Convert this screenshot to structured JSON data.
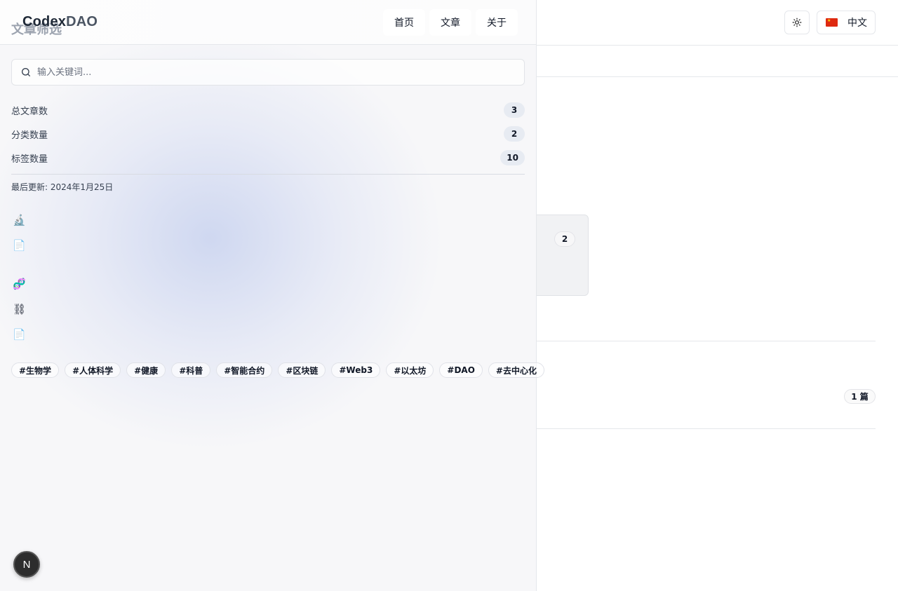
{
  "header": {
    "brand_part1": "Codex",
    "brand_part2": "DAO",
    "nav": [
      "首页",
      "文章",
      "关于"
    ],
    "language": "中文"
  },
  "panel": {
    "title": "文章筛选",
    "search_placeholder": "输入关键词...",
    "stats": [
      {
        "label": "总文章数",
        "value": "3"
      },
      {
        "label": "分类数量",
        "value": "2"
      },
      {
        "label": "标签数量",
        "value": "10"
      }
    ],
    "last_updated": "最后更新: 2024年1月25日",
    "category_icons": [
      "microscope-icon",
      "document-icon",
      "dna-icon",
      "chain-icon",
      "document-icon"
    ],
    "tags": [
      "#生物学",
      "#人体科学",
      "#健康",
      "#科普",
      "#智能合约",
      "#区块链",
      "#Web3",
      "#以太坊",
      "#DAO",
      "#去中心化"
    ]
  },
  "background": {
    "card_count": "2",
    "article_count": "1 篇"
  },
  "fab": {
    "label": "N"
  }
}
